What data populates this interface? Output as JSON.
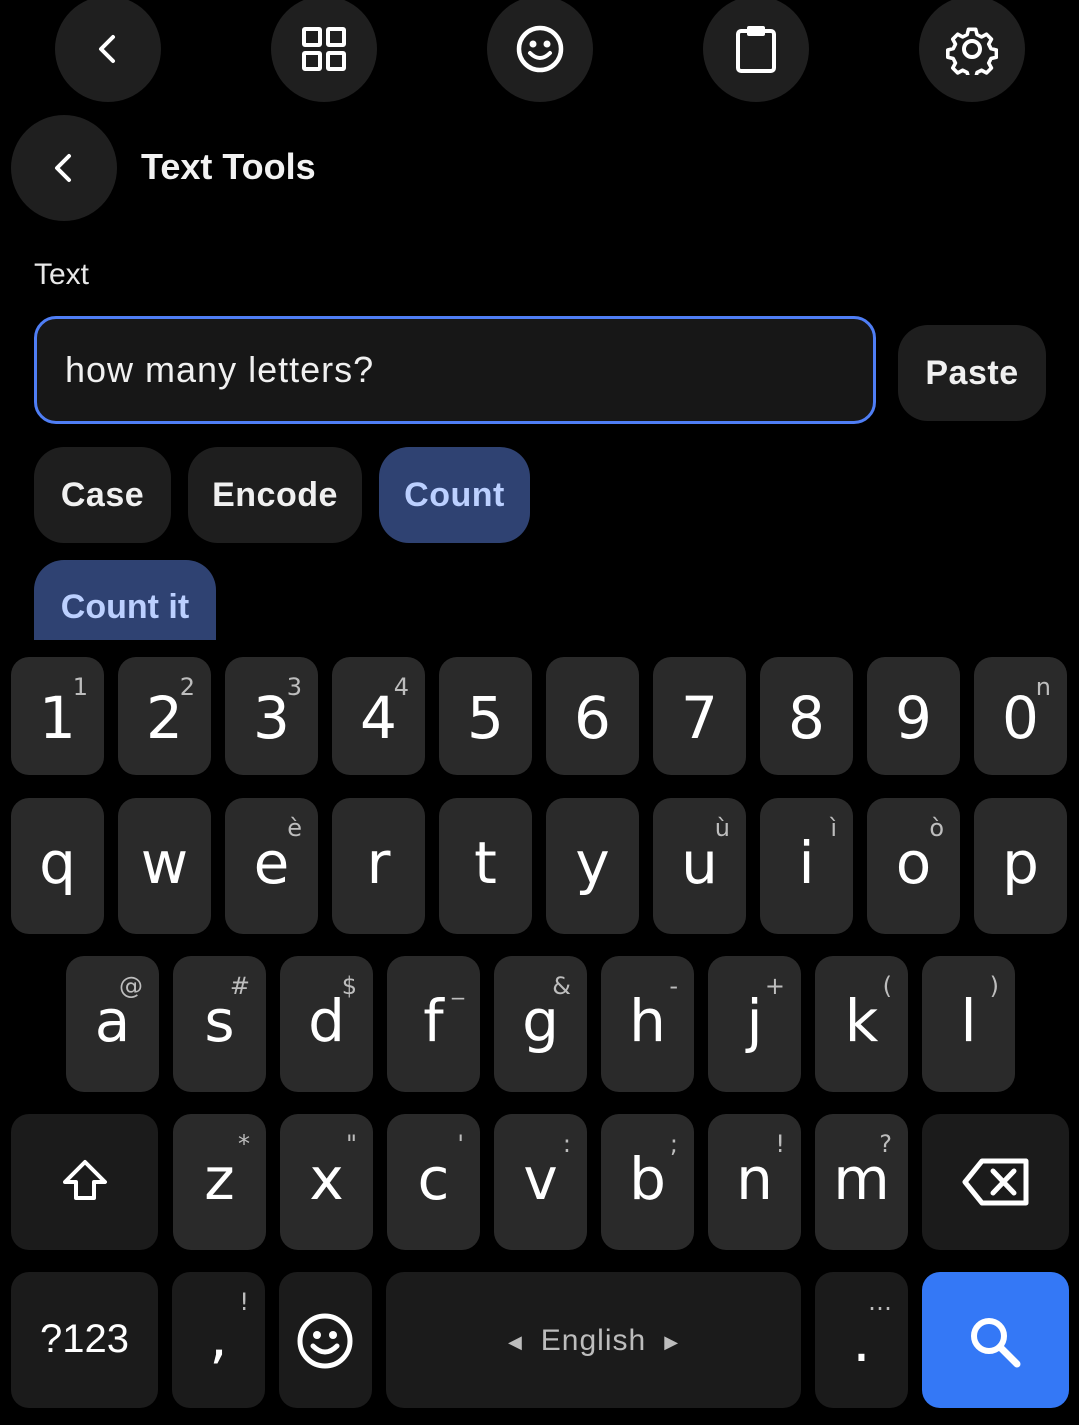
{
  "toolbar": {
    "icons": [
      "back-icon",
      "grid-icon",
      "emoji-icon",
      "clipboard-icon",
      "settings-icon"
    ]
  },
  "header": {
    "title": "Text Tools",
    "back_icon": "back-icon"
  },
  "text_field": {
    "label": "Text",
    "value": "how many letters?"
  },
  "paste_button": "Paste",
  "tabs": [
    {
      "label": "Case",
      "active": false
    },
    {
      "label": "Encode",
      "active": false
    },
    {
      "label": "Count",
      "active": true
    }
  ],
  "action_button": "Count it",
  "keyboard": {
    "row1": [
      {
        "key": "1",
        "hint": "1"
      },
      {
        "key": "2",
        "hint": "2"
      },
      {
        "key": "3",
        "hint": "3"
      },
      {
        "key": "4",
        "hint": "4"
      },
      {
        "key": "5",
        "hint": ""
      },
      {
        "key": "6",
        "hint": ""
      },
      {
        "key": "7",
        "hint": ""
      },
      {
        "key": "8",
        "hint": ""
      },
      {
        "key": "9",
        "hint": ""
      },
      {
        "key": "0",
        "hint": "n"
      }
    ],
    "row2": [
      {
        "key": "q",
        "hint": ""
      },
      {
        "key": "w",
        "hint": ""
      },
      {
        "key": "e",
        "hint": "è"
      },
      {
        "key": "r",
        "hint": ""
      },
      {
        "key": "t",
        "hint": ""
      },
      {
        "key": "y",
        "hint": ""
      },
      {
        "key": "u",
        "hint": "ù"
      },
      {
        "key": "i",
        "hint": "ì"
      },
      {
        "key": "o",
        "hint": "ò"
      },
      {
        "key": "p",
        "hint": ""
      }
    ],
    "row3": [
      {
        "key": "a",
        "hint": "@"
      },
      {
        "key": "s",
        "hint": "#"
      },
      {
        "key": "d",
        "hint": "$"
      },
      {
        "key": "f",
        "hint": "_"
      },
      {
        "key": "g",
        "hint": "&"
      },
      {
        "key": "h",
        "hint": "-"
      },
      {
        "key": "j",
        "hint": "+"
      },
      {
        "key": "k",
        "hint": "("
      },
      {
        "key": "l",
        "hint": ")"
      }
    ],
    "row4": [
      {
        "key": "z",
        "hint": "*"
      },
      {
        "key": "x",
        "hint": "\""
      },
      {
        "key": "c",
        "hint": "'"
      },
      {
        "key": "v",
        "hint": ":"
      },
      {
        "key": "b",
        "hint": ";"
      },
      {
        "key": "n",
        "hint": "!"
      },
      {
        "key": "m",
        "hint": "?"
      }
    ],
    "symbols_key": "?123",
    "comma_key": ",",
    "comma_hint": "!",
    "space_label": "English",
    "period_key": ".",
    "period_hint": "…",
    "colors": {
      "search": "#3478f6",
      "key": "#2a2a2a",
      "accent": "#4f7ef5"
    }
  }
}
